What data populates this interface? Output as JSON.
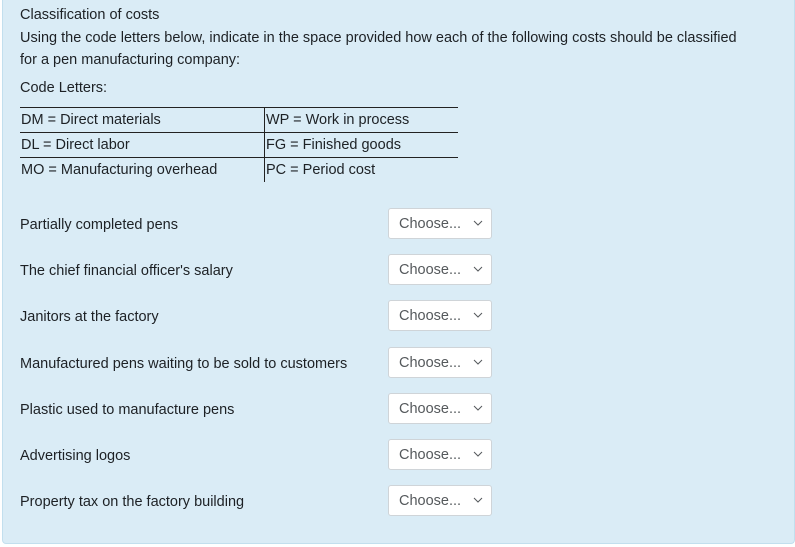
{
  "question": {
    "title": "Classification of costs",
    "instructions": "Using the code letters below, indicate in the space provided how each of the following costs should be classified for a pen manufacturing company:",
    "code_letters_label": "Code Letters:"
  },
  "code_table": {
    "rows": [
      {
        "left": "DM = Direct materials",
        "right": "WP = Work in process"
      },
      {
        "left": "DL = Direct labor",
        "right": "FG = Finished goods"
      },
      {
        "left": "MO = Manufacturing overhead",
        "right": "PC = Period cost"
      }
    ]
  },
  "items": [
    {
      "label": "Partially completed pens",
      "selected": "Choose..."
    },
    {
      "label": "The chief financial officer's salary",
      "selected": "Choose..."
    },
    {
      "label": "Janitors at the factory",
      "selected": "Choose..."
    },
    {
      "label": "Manufactured pens waiting to be sold to customers",
      "selected": "Choose..."
    },
    {
      "label": "Plastic used to manufacture pens",
      "selected": "Choose..."
    },
    {
      "label": "Advertising logos",
      "selected": "Choose..."
    },
    {
      "label": "Property tax on the factory building",
      "selected": "Choose..."
    }
  ],
  "icons": {
    "dropdown": "chevron-down-icon"
  },
  "colors": {
    "panel_background": "#daecf6",
    "panel_border": "#c2dfee",
    "select_border": "#cfd4d8",
    "text": "#1d2125"
  }
}
